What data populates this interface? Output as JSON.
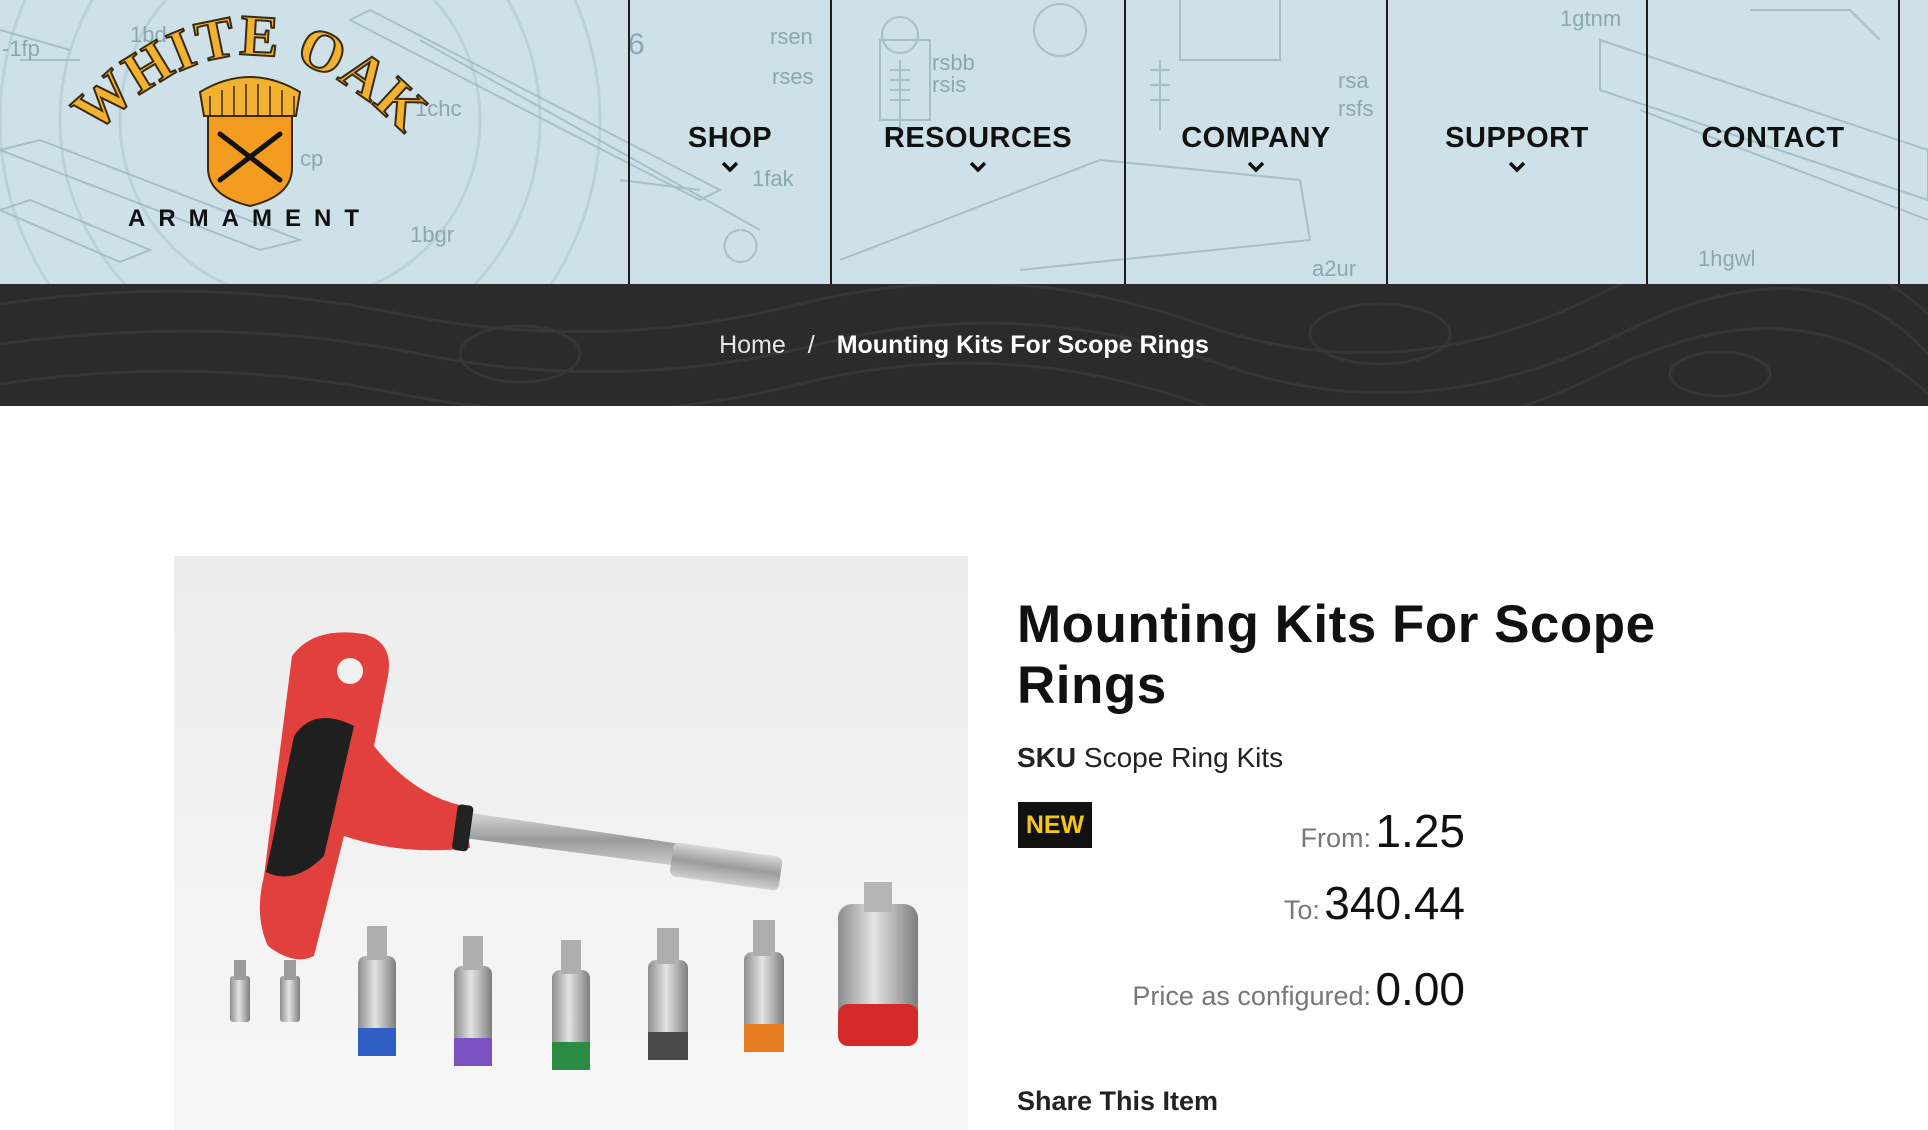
{
  "brand": {
    "name_line1": "WHITE OAK",
    "name_line2": "ARMAMENT"
  },
  "nav": [
    {
      "label": "SHOP",
      "has_dropdown": true
    },
    {
      "label": "RESOURCES",
      "has_dropdown": true
    },
    {
      "label": "COMPANY",
      "has_dropdown": true
    },
    {
      "label": "SUPPORT",
      "has_dropdown": true
    },
    {
      "label": "CONTACT",
      "has_dropdown": false
    }
  ],
  "diagram_labels": [
    "-1fp",
    "1bd",
    "1chc",
    "cp",
    "1bgr",
    "rsen",
    "rses",
    "rsbb",
    "rsis",
    "1fak",
    "rsa",
    "rsfs",
    "a2ur",
    "1gtnm",
    "1hgwl",
    "6"
  ],
  "breadcrumb": {
    "home": "Home",
    "separator": "/",
    "current": "Mounting Kits For Scope Rings"
  },
  "product": {
    "title": "Mounting Kits For Scope Rings",
    "sku_label": "SKU",
    "sku_value": "Scope Ring Kits",
    "badge": "NEW",
    "from_label": "From:",
    "from_value": "1.25",
    "to_label": "To:",
    "to_value": "340.44",
    "configured_label": "Price as configured:",
    "configured_value": "0.00",
    "share_label": "Share This Item"
  },
  "colors": {
    "header_bg": "#cfe1e8",
    "breadcrumb_bg": "#2b2b2b",
    "badge_bg": "#111111",
    "badge_text": "#f5c518",
    "logo_gold": "#f2b230"
  }
}
